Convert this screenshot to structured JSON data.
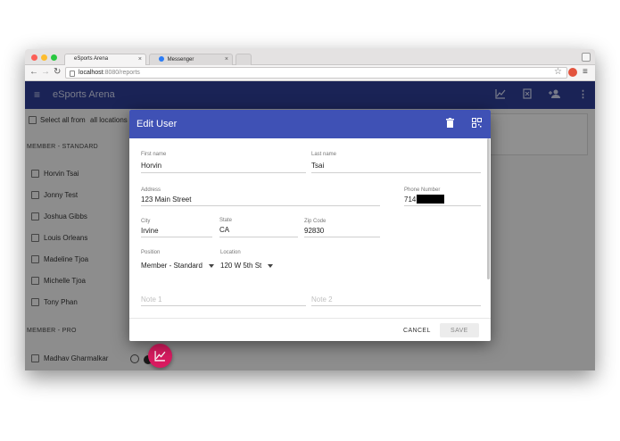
{
  "browser": {
    "tabs": [
      {
        "label": "eSports Arena",
        "close": "×"
      },
      {
        "label": "Messenger",
        "close": "×"
      }
    ],
    "url_host": "localhost",
    "url_port": ":8080",
    "url_path": "/reports"
  },
  "app": {
    "title": "eSports Arena",
    "select_all_label": "Select all from",
    "select_all_value": "all locations"
  },
  "sections": {
    "standard": {
      "label": "MEMBER - STANDARD",
      "members": [
        "Horvin Tsai",
        "Jonny Test",
        "Joshua Gibbs",
        "Louis Orleans",
        "Madeline Tjoa",
        "Michelle Tjoa",
        "Tony Phan"
      ]
    },
    "pro": {
      "label": "MEMBER - PRO",
      "members": [
        "Madhav Gharmalkar"
      ]
    }
  },
  "dialog": {
    "title": "Edit User",
    "first_name": {
      "label": "First name",
      "value": "Horvin"
    },
    "last_name": {
      "label": "Last name",
      "value": "Tsai"
    },
    "address": {
      "label": "Address",
      "value": "123 Main Street"
    },
    "phone": {
      "label": "Phone Number",
      "value": "714"
    },
    "city": {
      "label": "City",
      "value": "Irvine"
    },
    "state": {
      "label": "State",
      "value": "CA"
    },
    "zip": {
      "label": "Zip Code",
      "value": "92830"
    },
    "position": {
      "label": "Position",
      "value": "Member - Standard"
    },
    "location": {
      "label": "Location",
      "value": "120 W 5th St"
    },
    "note1": {
      "placeholder": "Note 1"
    },
    "note2": {
      "placeholder": "Note 2"
    },
    "cancel_label": "CANCEL",
    "save_label": "SAVE"
  },
  "colors": {
    "appbar": "#2e3d95",
    "dialog_header": "#3f51b5",
    "fab": "#d81b60"
  },
  "icons": [
    "menu-icon",
    "chart-icon",
    "report-icon",
    "add-user-icon",
    "more-vert-icon",
    "delete-icon",
    "qr-code-icon",
    "clock-icon"
  ]
}
